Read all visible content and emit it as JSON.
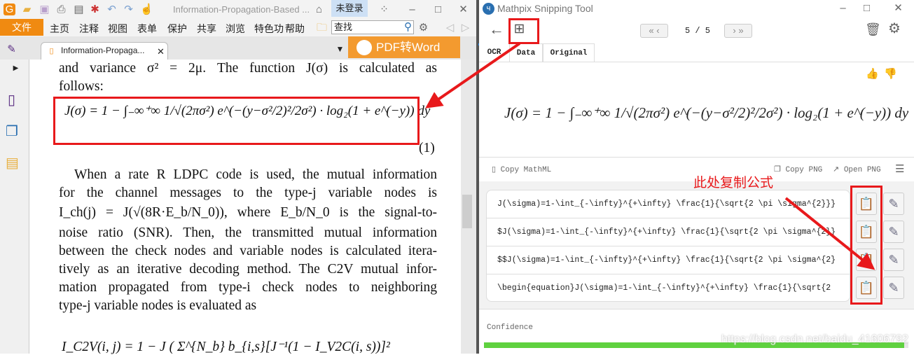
{
  "pdf_reader": {
    "doc_title": "Information-Propagation-Based ...",
    "login_label": "未登录",
    "file_menu": "文件",
    "menus": [
      "主页",
      "注释",
      "视图",
      "表单",
      "保护",
      "共享",
      "浏览",
      "特色功",
      "帮助"
    ],
    "search_placeholder": "查找",
    "tab_label": "Information-Propaga...",
    "pdf_to_word": "PDF转Word",
    "page_lines": [
      "and variance σ² = 2μ. The function J(σ) is calculated as",
      "follows:",
      "(1)",
      "When a rate R LDPC code is used, the mutual information",
      "for the channel messages to the type-j variable nodes is",
      "I_ch(j) = J(√(8R·E_b/N_0)), where E_b/N_0 is the signal-to-",
      "noise ratio (SNR). Then, the transmitted mutual information",
      "between the check nodes and variable nodes is calculated itera-",
      "tively as an iterative decoding method. The C2V mutual infor-",
      "mation propagated from type-i check nodes to neighboring",
      "type-j variable nodes is evaluated as"
    ],
    "equation": "J(σ) = 1 − ∫₋∞⁺∞ 1/√(2πσ²) e^(−(y−σ²/2)²/2σ²) · log₂(1 + e^(−y)) dy",
    "equation2": "I_C2V(i, j) = 1 − J ( Σ^{N_b} b_{i,s}[J⁻¹(1 − I_V2C(i, s))]²"
  },
  "mathpix": {
    "title": "Mathpix Snipping Tool",
    "pager": "5 / 5",
    "tabs": [
      "OCR",
      "Data",
      "Original"
    ],
    "active_tab": "OCR",
    "rendered": "J(σ) = 1 − ∫₋∞⁺∞ 1/√(2πσ²) e^(−(y−σ²/2)²/2σ²) · log₂(1 + e^(−y)) dy",
    "copy_mathml": "Copy MathML",
    "copy_png": "Copy PNG",
    "open_png": "Open PNG",
    "results": [
      "J(\\sigma)=1-\\int_{-\\infty}^{+\\infty} \\frac{1}{\\sqrt{2 \\pi \\sigma^{2}}}",
      "$J(\\sigma)=1-\\int_{-\\infty}^{+\\infty} \\frac{1}{\\sqrt{2 \\pi \\sigma^{2}}",
      "$$J(\\sigma)=1-\\int_{-\\infty}^{+\\infty} \\frac{1}{\\sqrt{2 \\pi \\sigma^{2}",
      "\\begin{equation}J(\\sigma)=1-\\int_{-\\infty}^{+\\infty} \\frac{1}{\\sqrt{2"
    ],
    "confidence_label": "Confidence",
    "confidence": 0.99,
    "accent": "#5fd13f"
  },
  "annotation": {
    "note": "此处复制公式",
    "color": "#e8191b"
  },
  "watermark": "https://blog.csdn.net/baidu_41606792"
}
